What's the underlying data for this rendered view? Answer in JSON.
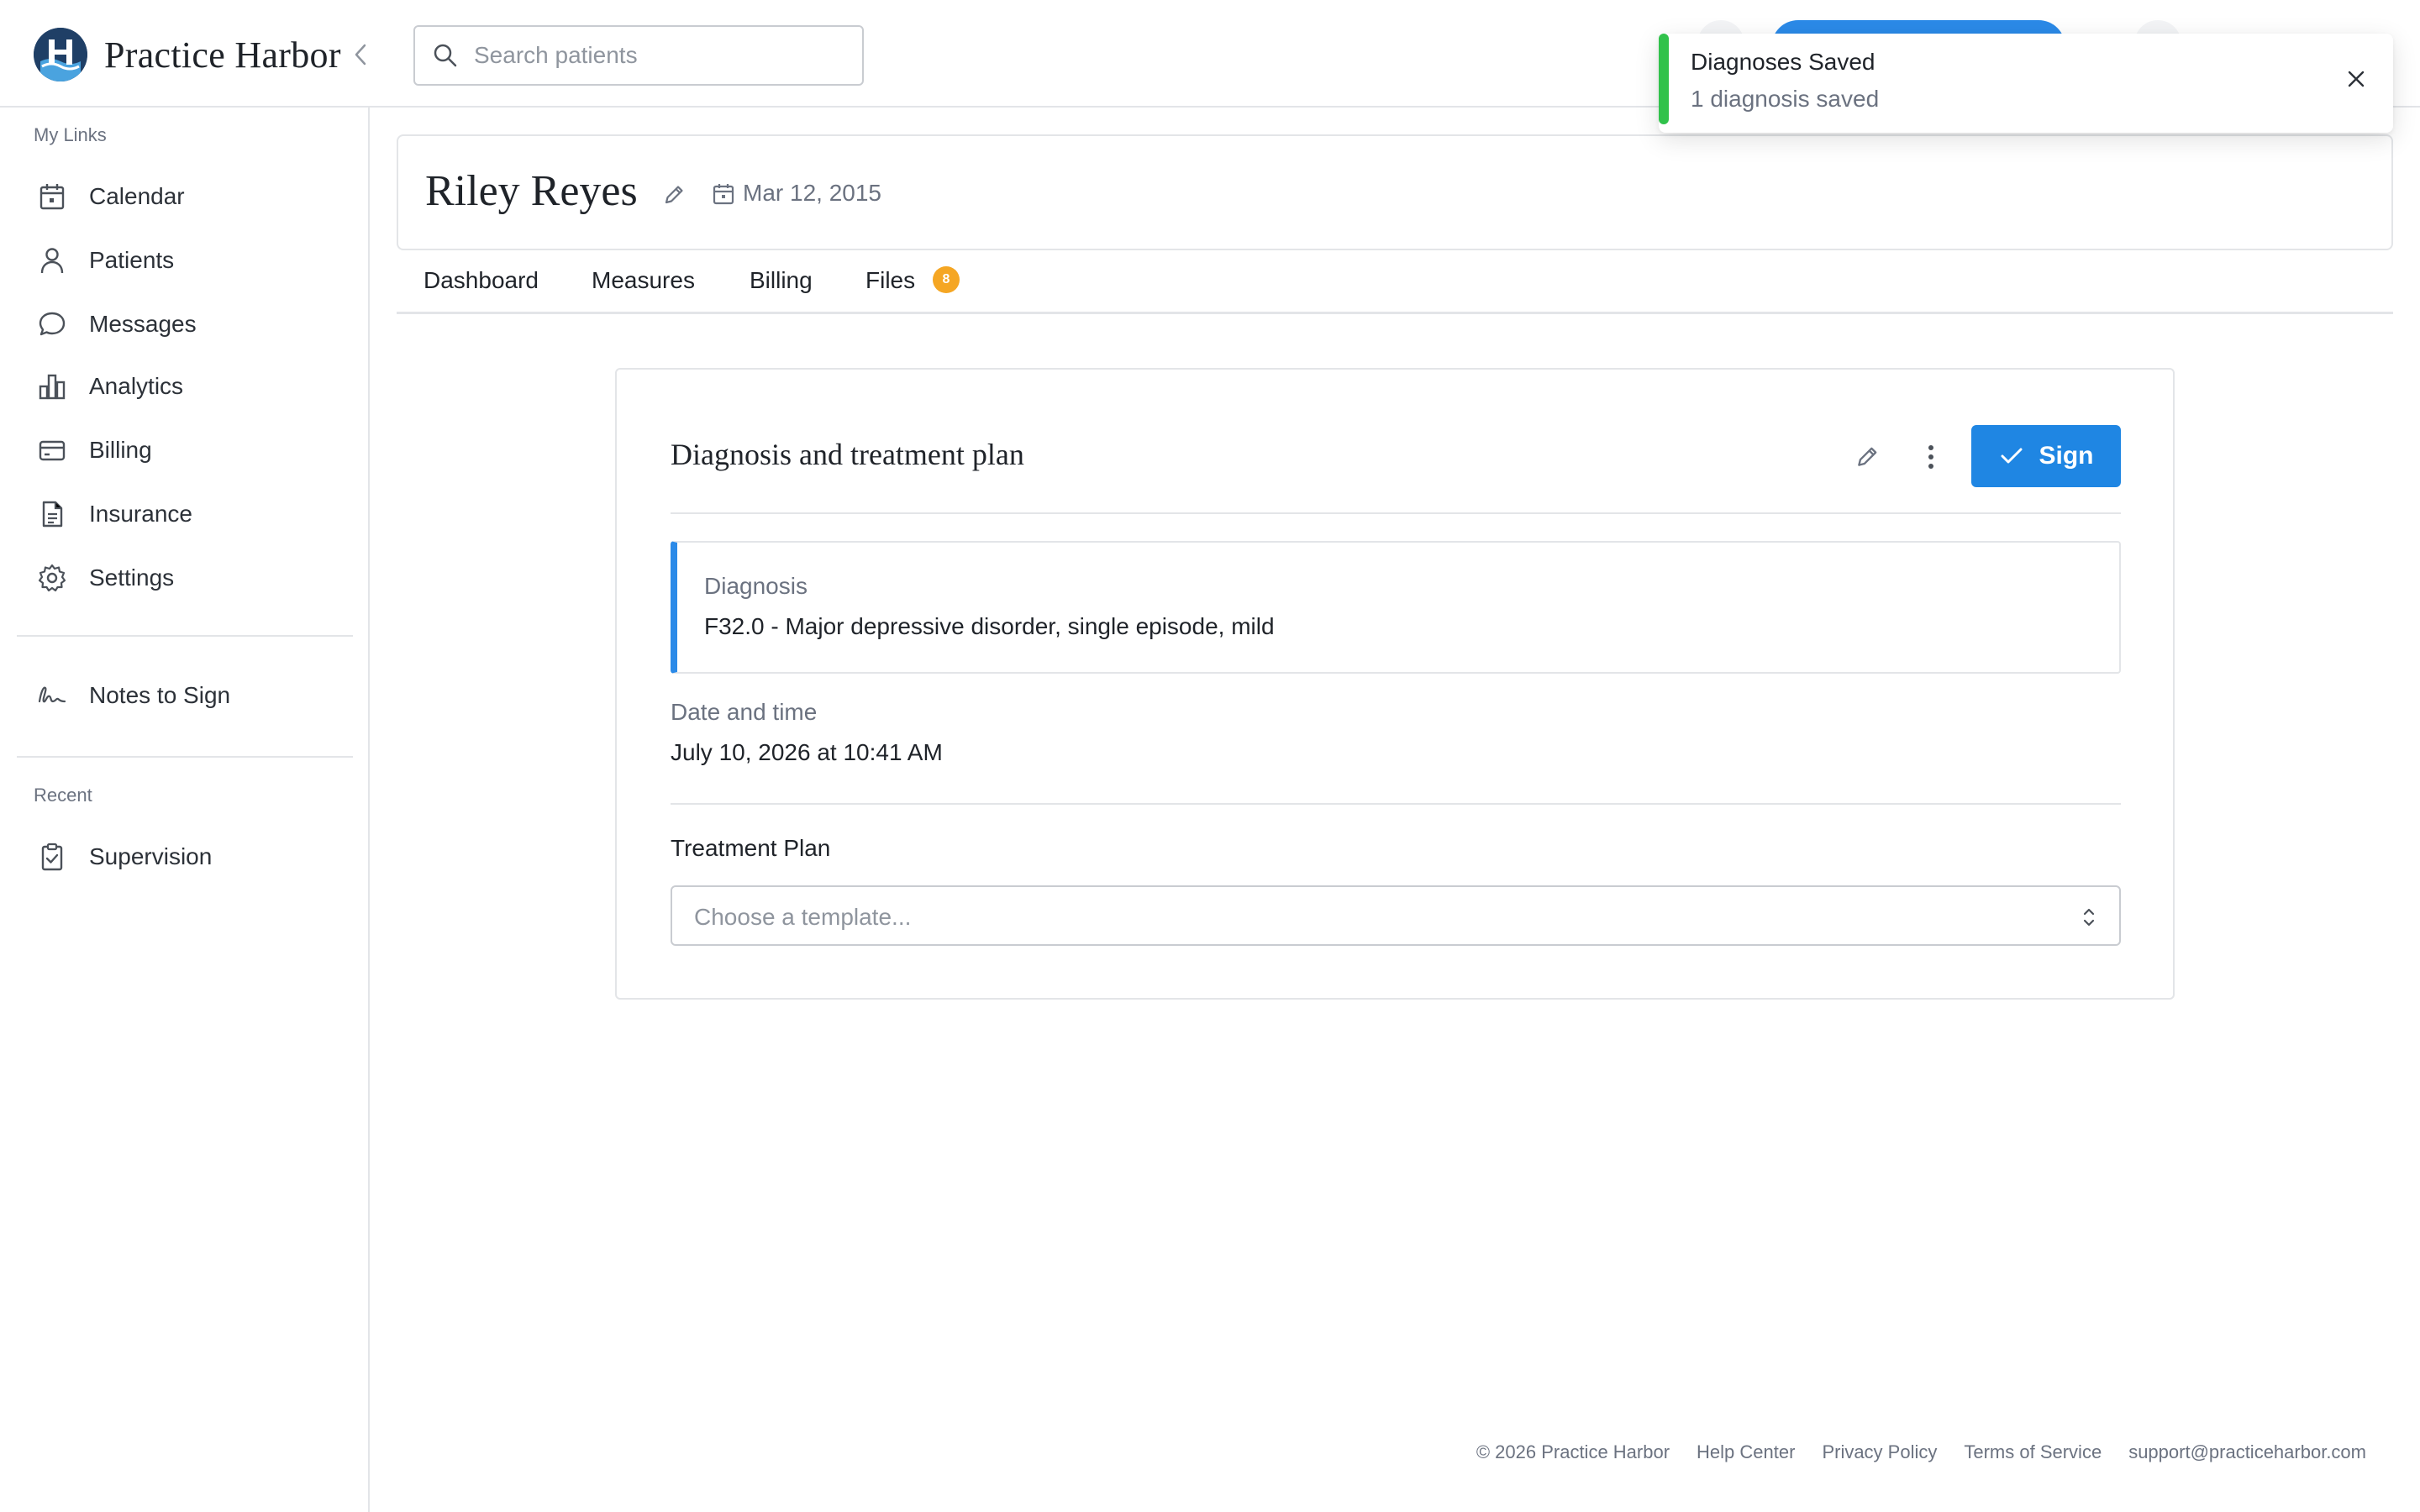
{
  "app": {
    "brand_name": "Practice Harbor"
  },
  "search": {
    "placeholder": "Search patients"
  },
  "sidebar": {
    "my_links_label": "My Links",
    "items": [
      {
        "label": "Calendar",
        "icon": "calendar-icon"
      },
      {
        "label": "Patients",
        "icon": "user-icon"
      },
      {
        "label": "Messages",
        "icon": "chat-bubble-icon"
      },
      {
        "label": "Analytics",
        "icon": "bar-chart-icon"
      },
      {
        "label": "Billing",
        "icon": "credit-card-icon"
      },
      {
        "label": "Insurance",
        "icon": "document-icon"
      },
      {
        "label": "Settings",
        "icon": "gear-icon"
      }
    ],
    "notes_to_sign": {
      "label": "Notes to Sign",
      "icon": "signature-icon"
    },
    "recent_label": "Recent",
    "recent_items": [
      {
        "label": "Supervision",
        "icon": "clipboard-check-icon"
      }
    ]
  },
  "patient": {
    "name": "Riley Reyes",
    "dob": "Mar 12, 2015"
  },
  "tabs": [
    {
      "label": "Dashboard"
    },
    {
      "label": "Measures"
    },
    {
      "label": "Billing"
    },
    {
      "label": "Files",
      "badge": "8"
    }
  ],
  "plan": {
    "title": "Diagnosis and treatment plan",
    "sign_label": "Sign",
    "diagnosis_label": "Diagnosis",
    "diagnosis_value": "F32.0 - Major depressive disorder, single episode, mild",
    "datetime_label": "Date and time",
    "datetime_value": "July 10, 2026 at 10:41 AM",
    "treatment_label": "Treatment Plan",
    "treatment_placeholder": "Choose a template..."
  },
  "toast": {
    "title": "Diagnoses Saved",
    "body": "1 diagnosis saved",
    "accent": "#31c24b"
  },
  "footer": {
    "copyright": "© 2026 Practice Harbor",
    "links": [
      "Help Center",
      "Privacy Policy",
      "Terms of Service",
      "support@practiceharbor.com"
    ]
  },
  "colors": {
    "primary": "#1f86e3",
    "badge": "#f5a623",
    "brand_dark": "#1f3f66"
  }
}
